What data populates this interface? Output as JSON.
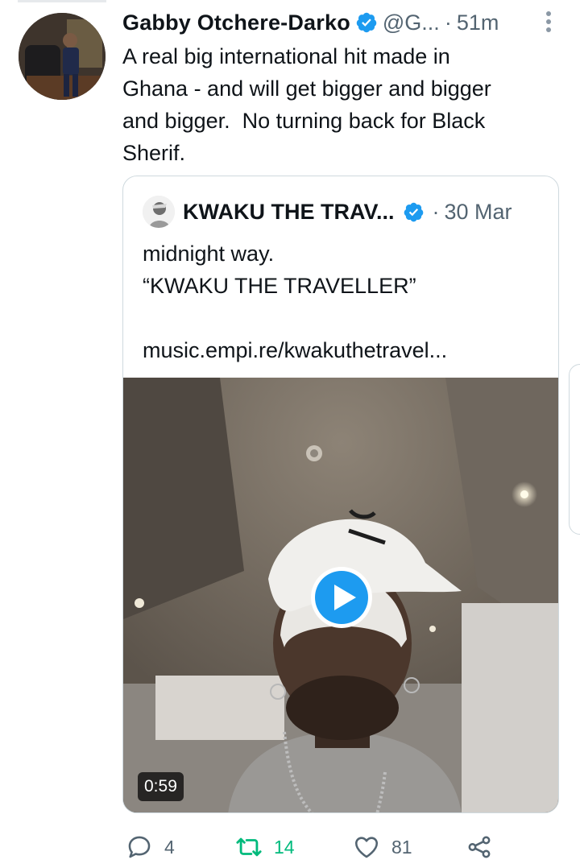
{
  "tweet": {
    "author_name": "Gabby Otchere-Darko",
    "handle": "@G...",
    "separator": "·",
    "time": "51m",
    "text": "A real big international hit made in\nGhana - and will get bigger and bigger\nand bigger.  No turning back for Black\nSherif."
  },
  "quote": {
    "author_name": "KWAKU THE TRAV...",
    "separator": "·",
    "time": "30 Mar",
    "text": "midnight way.\n“KWAKU THE TRAVELLER”\n\nmusic.empi.re/kwakuthetravel...",
    "video_duration": "0:59"
  },
  "actions": {
    "replies": "4",
    "retweets": "14",
    "likes": "81"
  },
  "colors": {
    "verified": "#1d9bf0",
    "retweet": "#00ba7c",
    "secondary_text": "#536471",
    "border": "#cfd9de"
  },
  "icons": [
    "verified-badge-icon",
    "more-options-icon",
    "play-icon",
    "reply-icon",
    "retweet-icon",
    "like-icon",
    "share-icon"
  ]
}
